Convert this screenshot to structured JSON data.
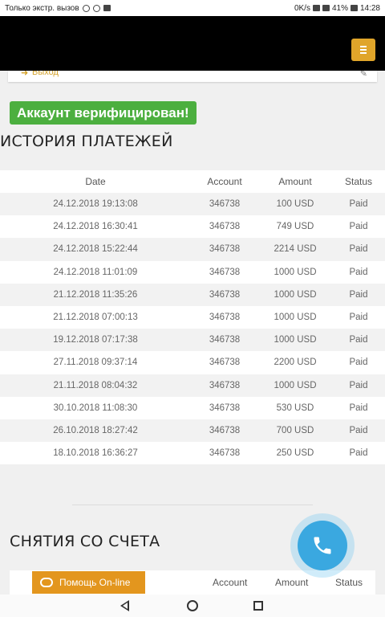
{
  "statusbar": {
    "left_text": "Только экстр. вызов",
    "right_text": "0K/s",
    "battery": "41%",
    "time": "14:28"
  },
  "header": {
    "menu_icon": "hamburger-icon",
    "accent": "#e0a52a"
  },
  "profile": {
    "logout_label": "Выход"
  },
  "verified_badge": {
    "text": "Аккаунт верифицирован!",
    "color": "#4caf3f"
  },
  "history": {
    "title": "ИСТОРИЯ ПЛАТЕЖЕЙ",
    "columns": [
      "Date",
      "Account",
      "Amount",
      "Status"
    ],
    "rows": [
      [
        "24.12.2018 19:13:08",
        "346738",
        "100 USD",
        "Paid"
      ],
      [
        "24.12.2018 16:30:41",
        "346738",
        "749 USD",
        "Paid"
      ],
      [
        "24.12.2018 15:22:44",
        "346738",
        "2214 USD",
        "Paid"
      ],
      [
        "24.12.2018 11:01:09",
        "346738",
        "1000 USD",
        "Paid"
      ],
      [
        "21.12.2018 11:35:26",
        "346738",
        "1000 USD",
        "Paid"
      ],
      [
        "21.12.2018 07:00:13",
        "346738",
        "1000 USD",
        "Paid"
      ],
      [
        "19.12.2018 07:17:38",
        "346738",
        "1000 USD",
        "Paid"
      ],
      [
        "27.11.2018 09:37:14",
        "346738",
        "2200 USD",
        "Paid"
      ],
      [
        "21.11.2018 08:04:32",
        "346738",
        "1000 USD",
        "Paid"
      ],
      [
        "30.10.2018 11:08:30",
        "346738",
        "530 USD",
        "Paid"
      ],
      [
        "26.10.2018 18:27:42",
        "346738",
        "700 USD",
        "Paid"
      ],
      [
        "18.10.2018 16:36:27",
        "346738",
        "250 USD",
        "Paid"
      ]
    ]
  },
  "withdrawals": {
    "title": "СНЯТИЯ СО СЧЕТА",
    "columns": [
      "Account",
      "Amount",
      "Status"
    ]
  },
  "help_button": {
    "label": "Помощь On-line",
    "color": "#e3961e"
  },
  "call_button": {
    "icon": "phone-icon",
    "color": "#3aa8e0"
  }
}
